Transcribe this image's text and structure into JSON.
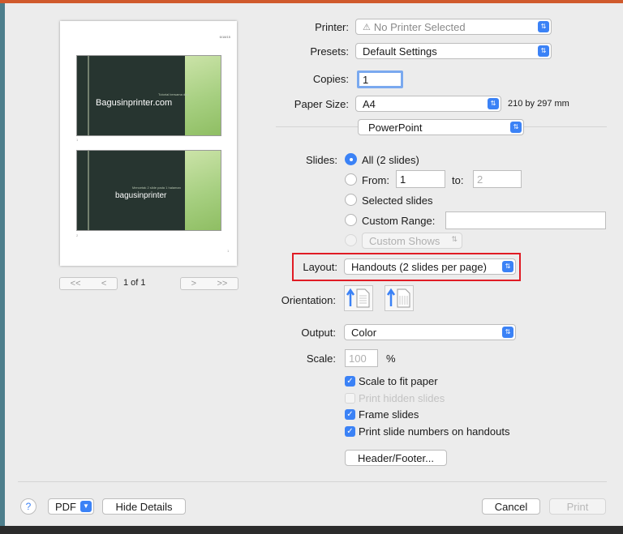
{
  "preview": {
    "date": "6/18/15",
    "slide1_subtitle": "Tutorial bersama dari",
    "slide1_title": "Bagusinprinter.com",
    "slide1_num": "1",
    "slide2_subtitle": "Mencetak 2 slide pada 1 halaman",
    "slide2_title": "bagusinprinter",
    "slide2_num": "2",
    "page_footer_num": "1",
    "pager_first": "<<",
    "pager_prev": "<",
    "pager_next": ">",
    "pager_last": ">>",
    "page_label": "1 of 1"
  },
  "form": {
    "printer_label": "Printer:",
    "printer_value": "No Printer Selected",
    "printer_icon": "warning-icon",
    "presets_label": "Presets:",
    "presets_value": "Default Settings",
    "copies_label": "Copies:",
    "copies_value": "1",
    "paper_label": "Paper Size:",
    "paper_value": "A4",
    "paper_dims": "210 by 297 mm",
    "section_value": "PowerPoint",
    "slides_label": "Slides:",
    "slides_all": "All  (2 slides)",
    "slides_from": "From:",
    "from_value": "1",
    "slides_to": "to:",
    "to_value": "2",
    "slides_selected": "Selected slides",
    "slides_custom_range": "Custom Range:",
    "custom_shows": "Custom Shows",
    "layout_label": "Layout:",
    "layout_value": "Handouts (2 slides per page)",
    "orientation_label": "Orientation:",
    "output_label": "Output:",
    "output_value": "Color",
    "scale_label": "Scale:",
    "scale_value": "100",
    "scale_unit": "%",
    "cb_scale_fit": "Scale to fit paper",
    "cb_hidden": "Print hidden slides",
    "cb_frame": "Frame slides",
    "cb_numbers": "Print slide numbers on handouts",
    "header_footer": "Header/Footer..."
  },
  "footer": {
    "help": "?",
    "pdf": "PDF",
    "hide_details": "Hide Details",
    "cancel": "Cancel",
    "print": "Print"
  },
  "colors": {
    "accent": "#3b82f6",
    "highlight": "#e01b24"
  }
}
